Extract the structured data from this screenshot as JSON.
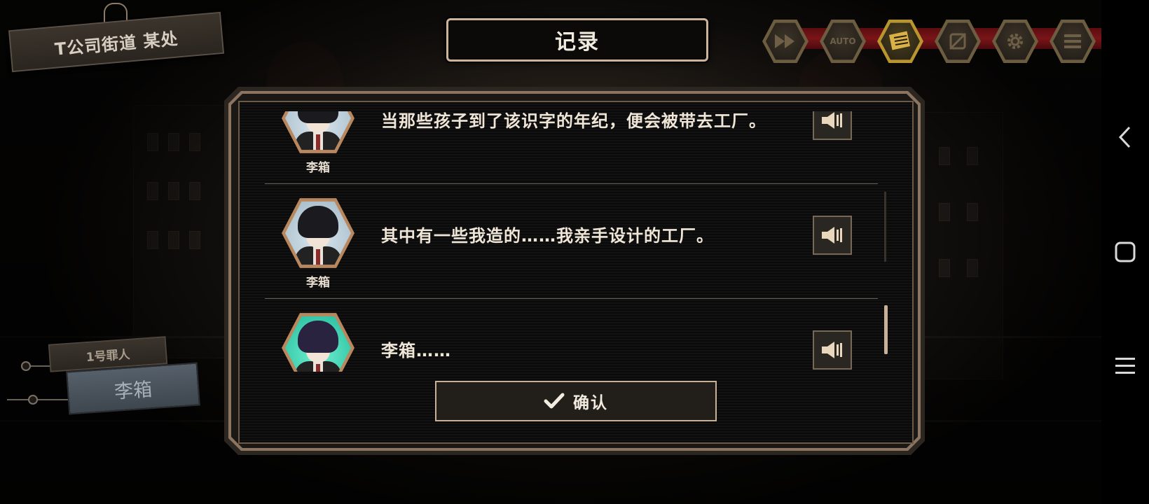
{
  "location": {
    "label": "T公司街道 某处"
  },
  "title": "记录",
  "toolbar": {
    "buttons": [
      {
        "name": "fast-forward",
        "icon": "fast-forward-icon"
      },
      {
        "name": "auto",
        "icon": "auto-icon",
        "label": "AUTO"
      },
      {
        "name": "log",
        "icon": "log-icon",
        "active": true
      },
      {
        "name": "hide-ui",
        "icon": "hide-ui-icon"
      },
      {
        "name": "settings",
        "icon": "gear-icon"
      },
      {
        "name": "menu",
        "icon": "menu-icon"
      }
    ]
  },
  "name_tags": {
    "small": "1号罪人",
    "big": "李箱"
  },
  "log": {
    "entries": [
      {
        "speaker": "李箱",
        "text": "当那些孩子到了该识字的年纪，便会被带去工厂。",
        "portrait": "blue"
      },
      {
        "speaker": "李箱",
        "text": "其中有一些我造的……我亲手设计的工厂。",
        "portrait": "blue"
      },
      {
        "speaker": "",
        "text": "李箱……",
        "portrait": "teal"
      }
    ]
  },
  "confirm": {
    "label": "确认"
  },
  "colors": {
    "accent": "#c9b198",
    "active_gold": "#d9b144",
    "toolbar_red": "#7a1419"
  },
  "system_nav": {
    "icons": [
      "back-icon",
      "recents-icon",
      "menu-lines-icon"
    ]
  }
}
